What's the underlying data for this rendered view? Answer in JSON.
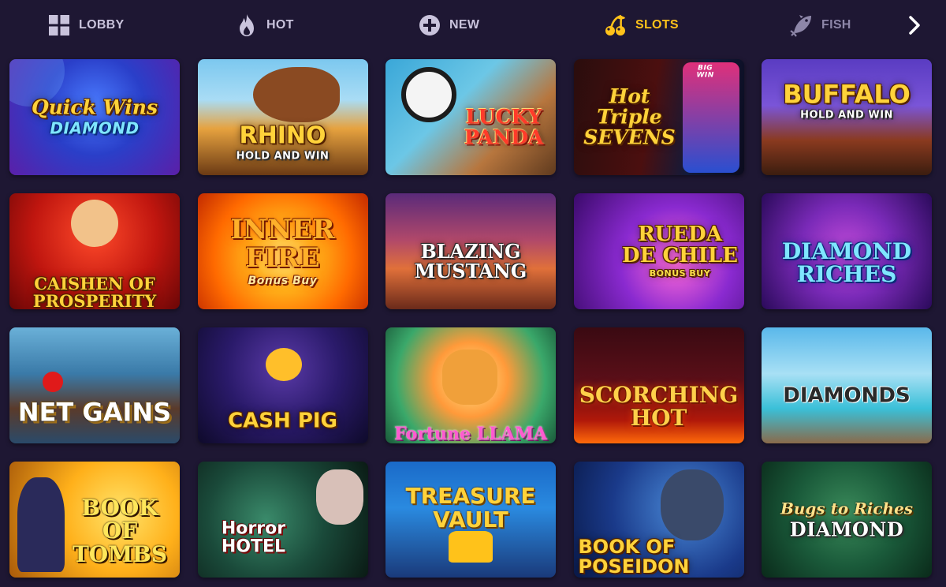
{
  "nav": {
    "items": [
      {
        "label": "LOBBY",
        "icon": "grid-icon",
        "state": "default"
      },
      {
        "label": "HOT",
        "icon": "flame-icon",
        "state": "default"
      },
      {
        "label": "NEW",
        "icon": "plus-circle-icon",
        "state": "default"
      },
      {
        "label": "SLOTS",
        "icon": "cherries-icon",
        "state": "active"
      },
      {
        "label": "FISH",
        "icon": "fish-icon",
        "state": "muted"
      }
    ],
    "next_icon": "chevron-right-icon"
  },
  "colors": {
    "background": "#1e1733",
    "nav_text": "#c9c3dc",
    "nav_active": "#ffc21a",
    "nav_muted": "#8d86a8"
  },
  "games": [
    {
      "title": "Quick Wins",
      "subtitle": "DIAMOND"
    },
    {
      "title": "RHINO",
      "subtitle": "HOLD AND WIN"
    },
    {
      "title": "LUCKY PANDA",
      "subtitle": ""
    },
    {
      "title": "Hot Triple SEVENS",
      "subtitle": "BIG WIN"
    },
    {
      "title": "BUFFALO",
      "subtitle": "HOLD AND WIN"
    },
    {
      "title": "CAISHEN OF PROSPERITY",
      "subtitle": ""
    },
    {
      "title": "INNER FIRE",
      "subtitle": "Bonus Buy"
    },
    {
      "title": "BLAZING MUSTANG",
      "subtitle": ""
    },
    {
      "title": "RUEDA DE CHILE",
      "subtitle": "BONUS BUY"
    },
    {
      "title": "DIAMOND RICHES",
      "subtitle": ""
    },
    {
      "title": "NET GAINS",
      "subtitle": ""
    },
    {
      "title": "CASH PIG",
      "subtitle": ""
    },
    {
      "title": "Fortune LLAMA",
      "subtitle": ""
    },
    {
      "title": "SCORCHING HOT",
      "subtitle": ""
    },
    {
      "title": "DIAMONDS",
      "subtitle": ""
    },
    {
      "title": "BOOK OF TOMBS",
      "subtitle": ""
    },
    {
      "title": "Horror HOTEL",
      "subtitle": ""
    },
    {
      "title": "TREASURE VAULT",
      "subtitle": ""
    },
    {
      "title": "BOOK OF POSEIDON",
      "subtitle": ""
    },
    {
      "title": "Bugs to Riches",
      "subtitle": "DIAMOND"
    }
  ]
}
